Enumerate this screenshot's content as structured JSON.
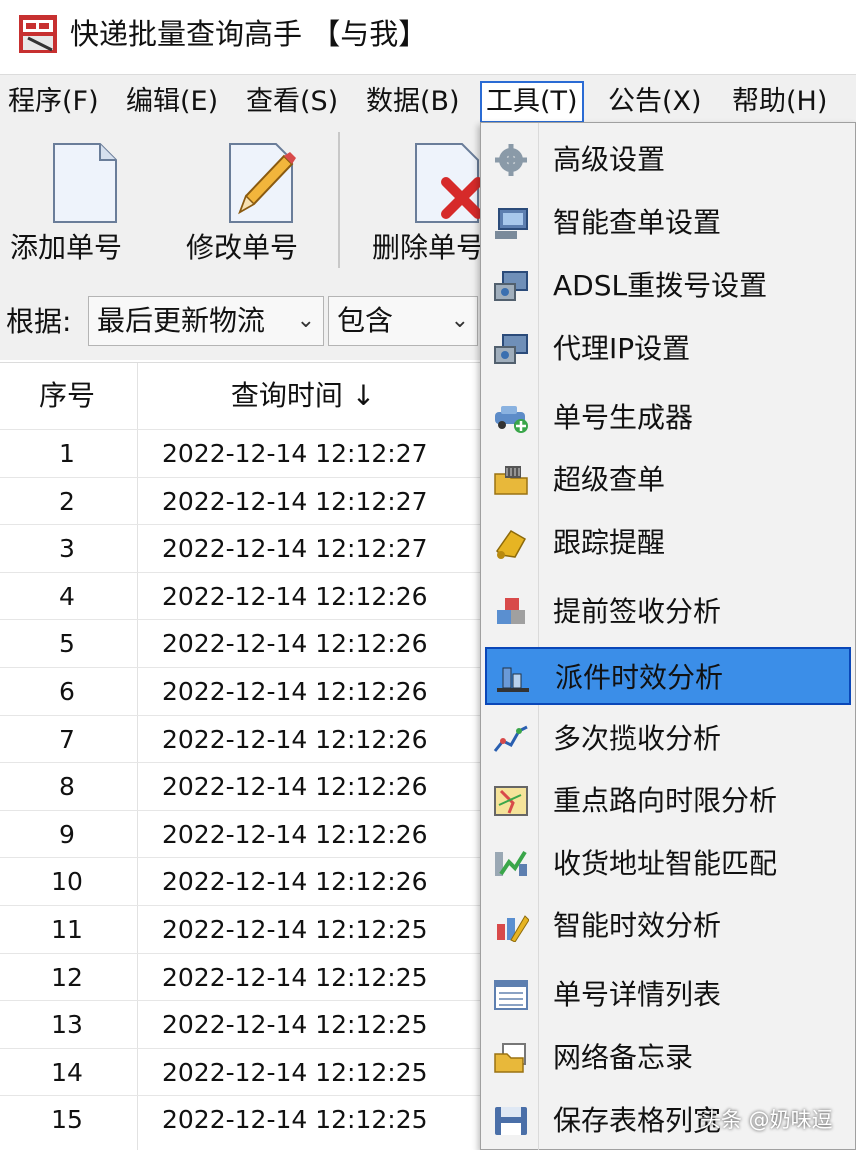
{
  "window": {
    "title": "快递批量查询高手 【与我】"
  },
  "menubar": {
    "items": [
      "程序(F)",
      "编辑(E)",
      "查看(S)",
      "数据(B)",
      "工具(T)",
      "公告(X)",
      "帮助(H)"
    ],
    "active": "工具(T)"
  },
  "toolbar": {
    "add_label": "添加单号",
    "edit_label": "修改单号",
    "delete_label": "删除单号"
  },
  "filter": {
    "label": "根据:",
    "field_value": "最后更新物流",
    "op_value": "包含"
  },
  "table": {
    "headers": [
      "序号",
      "查询时间 ↓"
    ],
    "rows": [
      {
        "no": "1",
        "time": "2022-12-14 12:12:27"
      },
      {
        "no": "2",
        "time": "2022-12-14 12:12:27"
      },
      {
        "no": "3",
        "time": "2022-12-14 12:12:27"
      },
      {
        "no": "4",
        "time": "2022-12-14 12:12:26"
      },
      {
        "no": "5",
        "time": "2022-12-14 12:12:26"
      },
      {
        "no": "6",
        "time": "2022-12-14 12:12:26"
      },
      {
        "no": "7",
        "time": "2022-12-14 12:12:26"
      },
      {
        "no": "8",
        "time": "2022-12-14 12:12:26"
      },
      {
        "no": "9",
        "time": "2022-12-14 12:12:26"
      },
      {
        "no": "10",
        "time": "2022-12-14 12:12:26"
      },
      {
        "no": "11",
        "time": "2022-12-14 12:12:25"
      },
      {
        "no": "12",
        "time": "2022-12-14 12:12:25"
      },
      {
        "no": "13",
        "time": "2022-12-14 12:12:25"
      },
      {
        "no": "14",
        "time": "2022-12-14 12:12:25"
      },
      {
        "no": "15",
        "time": "2022-12-14 12:12:25"
      }
    ]
  },
  "tools_menu": {
    "items": [
      {
        "label": "高级设置",
        "icon": "gear-icon"
      },
      {
        "label": "智能查单设置",
        "icon": "computer-icon"
      },
      {
        "label": "ADSL重拨号设置",
        "icon": "network-icon"
      },
      {
        "label": "代理IP设置",
        "icon": "network-icon"
      },
      {
        "label": "单号生成器",
        "icon": "car-add-icon"
      },
      {
        "label": "超级查单",
        "icon": "folder-icon"
      },
      {
        "label": "跟踪提醒",
        "icon": "bell-icon"
      },
      {
        "label": "提前签收分析",
        "icon": "cubes-icon"
      },
      {
        "label": "派件时效分析",
        "icon": "bar-chart-icon"
      },
      {
        "label": "多次揽收分析",
        "icon": "line-chart-icon"
      },
      {
        "label": "重点路向时限分析",
        "icon": "map-icon"
      },
      {
        "label": "收货地址智能匹配",
        "icon": "address-match-icon"
      },
      {
        "label": "智能时效分析",
        "icon": "chart-pencil-icon"
      },
      {
        "label": "单号详情列表",
        "icon": "list-icon"
      },
      {
        "label": "网络备忘录",
        "icon": "notes-icon"
      },
      {
        "label": "保存表格列宽",
        "icon": "save-icon"
      }
    ],
    "selected_index": 8
  },
  "watermark": "头条 @奶味逗",
  "colors": {
    "menu_highlight": "#3b8ee8",
    "menu_highlight_border": "#0a47b8",
    "chrome": "#f0f0f0"
  }
}
